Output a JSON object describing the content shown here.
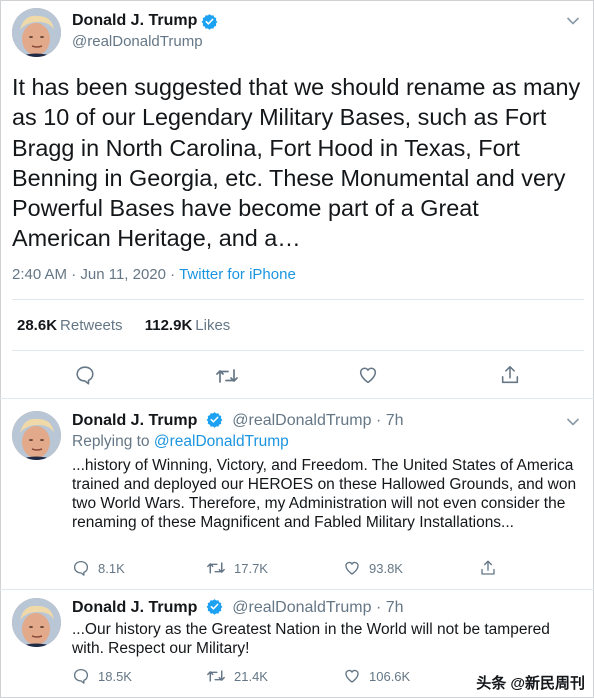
{
  "main_tweet": {
    "name": "Donald J. Trump",
    "handle": "@realDonaldTrump",
    "text": "It has been suggested that we should rename as many as 10 of our Legendary Military Bases, such as Fort Bragg in North Carolina, Fort Hood in Texas, Fort Benning in Georgia, etc. These Monumental and very Powerful Bases have become part of a Great American Heritage, and a…",
    "time": "2:40 AM · Jun 11, 2020 · ",
    "source": "Twitter for iPhone",
    "retweets_count": "28.6K",
    "retweets_label": "Retweets",
    "likes_count": "112.9K",
    "likes_label": "Likes"
  },
  "replies": [
    {
      "name": "Donald J. Trump",
      "handle": "@realDonaldTrump · 7h",
      "replying_prefix": "Replying to ",
      "replying_to": "@realDonaldTrump",
      "text": "...history of Winning, Victory, and Freedom. The United States of America trained and deployed our HEROES on these Hallowed Grounds, and won two World Wars. Therefore, my Administration will not even consider the renaming of these Magnificent and Fabled Military Installations...",
      "replies": "8.1K",
      "retweets": "17.7K",
      "likes": "93.8K"
    },
    {
      "name": "Donald J. Trump",
      "handle": "@realDonaldTrump · 7h",
      "text": "...Our history as the Greatest Nation in the World will not be tampered with. Respect our Military!",
      "replies": "18.5K",
      "retweets": "21.4K",
      "likes": "106.6K"
    }
  ],
  "watermark": "头条 @新民周刊",
  "colors": {
    "accent": "#1b95e0",
    "muted": "#657786",
    "text": "#14171a"
  }
}
